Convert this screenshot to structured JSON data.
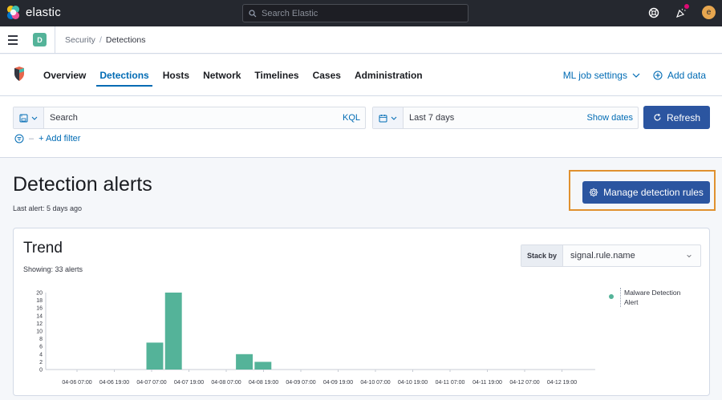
{
  "topbar": {
    "app_name": "elastic",
    "search_placeholder": "Search Elastic",
    "avatar_initial": "e"
  },
  "breadcrumb": {
    "space_initial": "D",
    "items": [
      "Security",
      "Detections"
    ],
    "separator": "/"
  },
  "nav": {
    "tabs": [
      {
        "label": "Overview",
        "active": false
      },
      {
        "label": "Detections",
        "active": true
      },
      {
        "label": "Hosts",
        "active": false
      },
      {
        "label": "Network",
        "active": false
      },
      {
        "label": "Timelines",
        "active": false
      },
      {
        "label": "Cases",
        "active": false
      },
      {
        "label": "Administration",
        "active": false
      }
    ],
    "ml_job_settings": "ML job settings",
    "add_data": "Add data"
  },
  "search": {
    "placeholder": "Search",
    "language": "KQL",
    "date_range": "Last 7 days",
    "show_dates": "Show dates",
    "refresh_label": "Refresh",
    "filter_separator": "–",
    "add_filter": "+ Add filter"
  },
  "page": {
    "title": "Detection alerts",
    "last_alert": "Last alert: 5 days ago",
    "manage_rules": "Manage detection rules"
  },
  "trend": {
    "title": "Trend",
    "showing": "Showing: 33 alerts",
    "stack_by_label": "Stack by",
    "stack_by_value": "signal.rule.name",
    "legend": [
      "Malware Detection Alert"
    ]
  },
  "colors": {
    "accent": "#006bb4",
    "primary_button": "#2b55a0",
    "series": "#54b399",
    "highlight": "#e0912f"
  },
  "chart_data": {
    "type": "bar",
    "title": "Trend",
    "xlabel": "",
    "ylabel": "",
    "ylim": [
      0,
      20
    ],
    "y_ticks": [
      0,
      2,
      4,
      6,
      8,
      10,
      12,
      14,
      16,
      18,
      20
    ],
    "x_ticks": [
      "04-06 07:00",
      "04-06 19:00",
      "04-07 07:00",
      "04-07 19:00",
      "04-08 07:00",
      "04-08 19:00",
      "04-09 07:00",
      "04-09 19:00",
      "04-10 07:00",
      "04-10 19:00",
      "04-11 07:00",
      "04-11 19:00",
      "04-12 07:00",
      "04-12 19:00"
    ],
    "series": [
      {
        "name": "Malware Detection Alert",
        "color": "#54b399",
        "bars": [
          {
            "x_index": 1.0,
            "width_ticks": 0.45,
            "value": 7
          },
          {
            "x_index": 1.5,
            "width_ticks": 0.45,
            "value": 20
          },
          {
            "x_index": 3.4,
            "width_ticks": 0.45,
            "value": 4
          },
          {
            "x_index": 3.9,
            "width_ticks": 0.45,
            "value": 2
          }
        ]
      }
    ]
  }
}
